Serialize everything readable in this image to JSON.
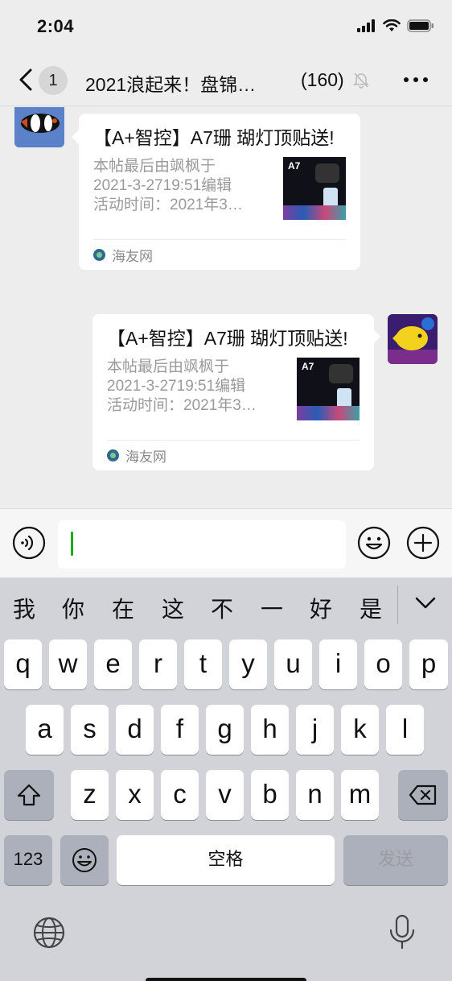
{
  "status_bar": {
    "time": "2:04"
  },
  "nav": {
    "unread_badge": "1",
    "title": "2021浪起来！盘锦…",
    "member_count": "(160)"
  },
  "messages": [
    {
      "side": "left",
      "card_title": "【A+智控】A7珊 瑚灯顶贴送!",
      "desc_lines": [
        "本帖最后由飒枫于",
        "2021-3-2719:51编辑",
        "活动时间：2021年3…"
      ],
      "thumb_label": "A7",
      "source": "海友网"
    },
    {
      "side": "right",
      "card_title": "【A+智控】A7珊 瑚灯顶贴送!",
      "desc_lines": [
        "本帖最后由飒枫于",
        "2021-3-2719:51编辑",
        "活动时间：2021年3…"
      ],
      "thumb_label": "A7",
      "source": "海友网"
    }
  ],
  "input": {
    "value": ""
  },
  "keyboard": {
    "candidates": [
      "我",
      "你",
      "在",
      "这",
      "不",
      "一",
      "好",
      "是"
    ],
    "row1": [
      "q",
      "w",
      "e",
      "r",
      "t",
      "y",
      "u",
      "i",
      "o",
      "p"
    ],
    "row2": [
      "a",
      "s",
      "d",
      "f",
      "g",
      "h",
      "j",
      "k",
      "l"
    ],
    "row3": [
      "z",
      "x",
      "c",
      "v",
      "b",
      "n",
      "m"
    ],
    "numbers_label": "123",
    "space_label": "空格",
    "send_label": "发送"
  }
}
